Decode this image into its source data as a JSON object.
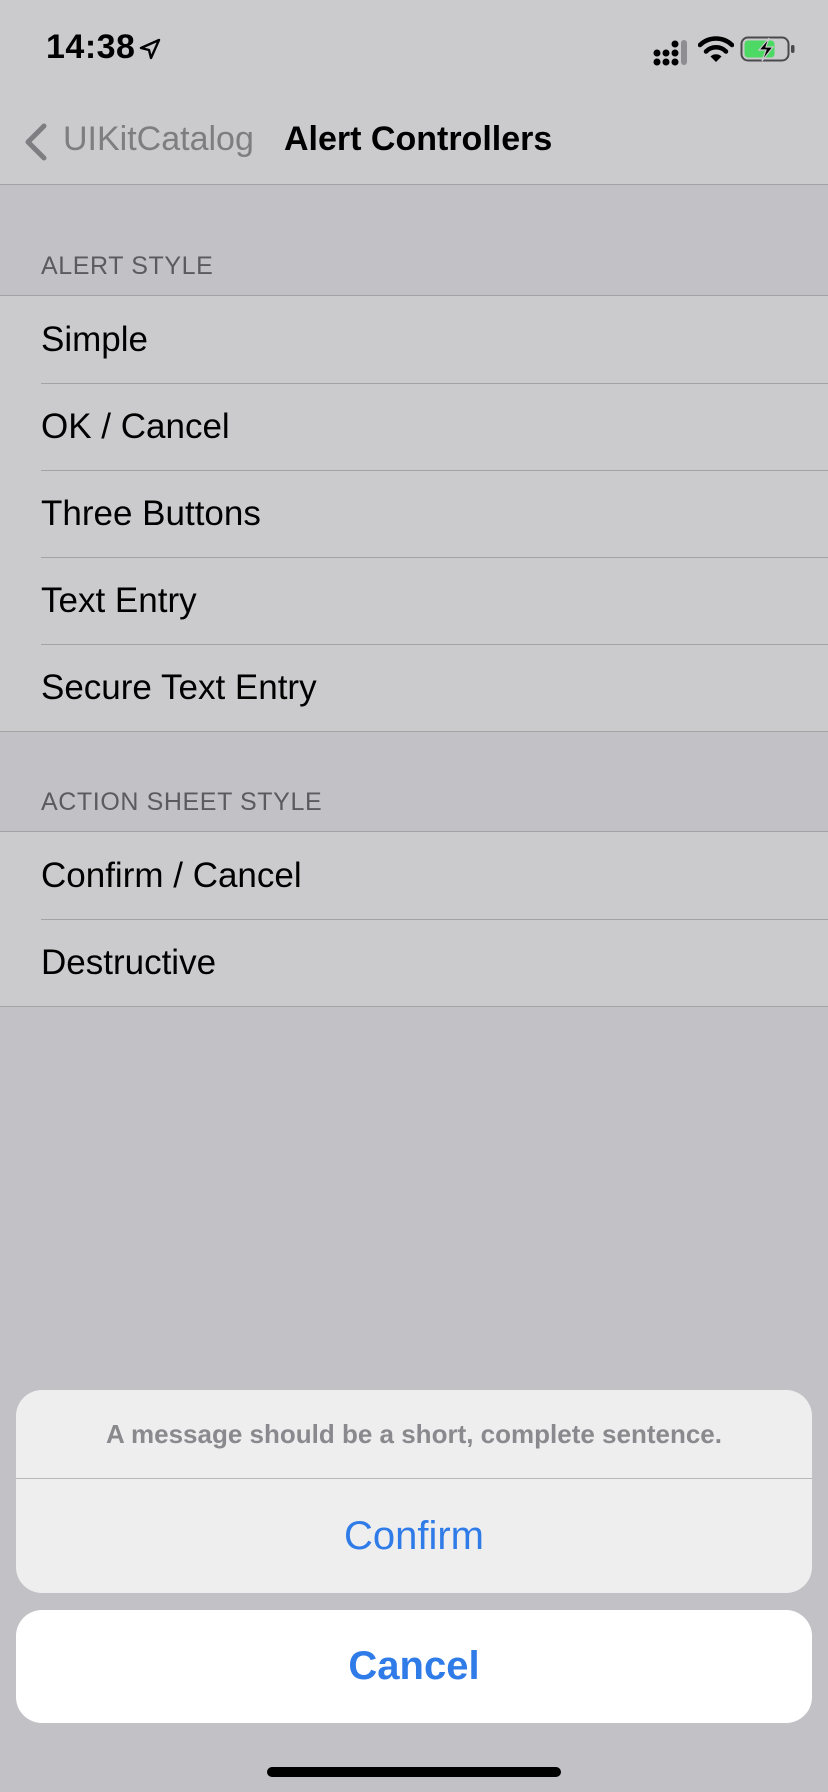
{
  "status_bar": {
    "time": "14:38"
  },
  "nav": {
    "back_label": "UIKitCatalog",
    "title": "Alert Controllers"
  },
  "sections": [
    {
      "header": "ALERT STYLE",
      "rows": [
        "Simple",
        "OK / Cancel",
        "Three Buttons",
        "Text Entry",
        "Secure Text Entry"
      ]
    },
    {
      "header": "ACTION SHEET STYLE",
      "rows": [
        "Confirm / Cancel",
        "Destructive"
      ]
    }
  ],
  "action_sheet": {
    "message": "A message should be a short, complete sentence.",
    "confirm_label": "Confirm",
    "cancel_label": "Cancel"
  },
  "colors": {
    "accent": "#2f7be8",
    "dimmed_background": "#c2c2c6",
    "battery_fill": "#4cd964"
  },
  "icons": [
    "location-arrow-icon",
    "cellular-signal-icon",
    "wifi-icon",
    "battery-charging-icon",
    "chevron-left-icon"
  ]
}
